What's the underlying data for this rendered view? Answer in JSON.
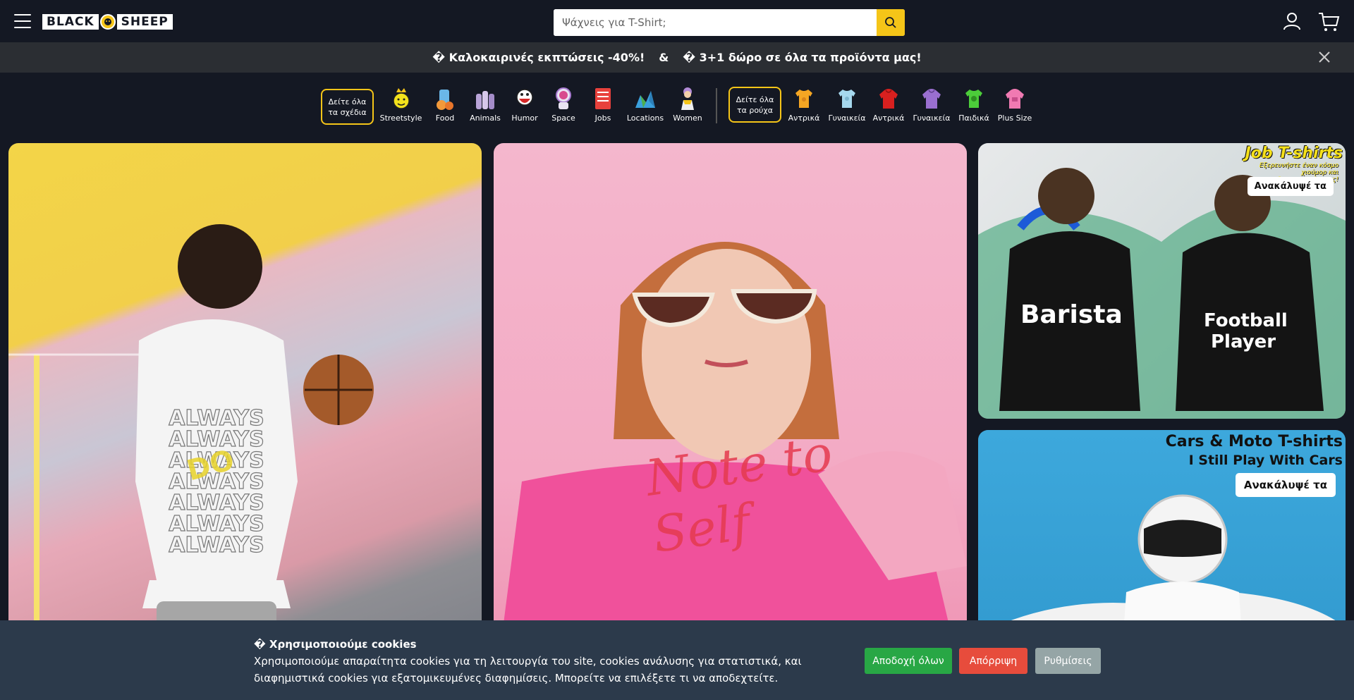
{
  "header": {
    "logo_text_left": "BLACK",
    "logo_text_right": "SHEEP",
    "search_placeholder": "Ψάχνεις για T-Shirt;"
  },
  "promo": {
    "text_1": "� Καλοκαιρινές εκπτώσεις -40%!",
    "separator": "&",
    "text_2": "� 3+1 δώρο σε όλα τα προϊόντα μας!"
  },
  "categories": {
    "designs_button": "Δείτε όλα τα σχέδια",
    "designs": [
      "Streetstyle",
      "Food",
      "Animals",
      "Humor",
      "Space",
      "Jobs",
      "Locations",
      "Women"
    ],
    "clothes_button": "Δείτε όλα τα ρούχα",
    "clothes": [
      "Αντρικά",
      "Γυναικεία",
      "Αντρικά",
      "Γυναικεία",
      "Παιδικά",
      "Plus Size"
    ]
  },
  "cards": {
    "job_title": "Job T-shirts",
    "job_subtitle": "Εξερευνήστε έναν κόσμο χιούμορ και δημιουργικότητας!",
    "job_button": "Ανακάλυψέ τα",
    "cars_title_1": "Cars & Moto T-shirts",
    "cars_title_2": "I Still Play With Cars",
    "cars_button": "Ανακάλυψέ τα"
  },
  "cookie": {
    "title": "� Χρησιμοποιούμε cookies",
    "body": "Χρησιμοποιούμε απαραίτητα cookies για τη λειτουργία του site, cookies ανάλυσης για στατιστικά, και διαφημιστικά cookies για εξατομικευμένες διαφημίσεις. Μπορείτε να επιλέξετε τι να αποδεχτείτε.",
    "accept": "Αποδοχή όλων",
    "reject": "Απόρριψη",
    "settings": "Ρυθμίσεις"
  },
  "colors": {
    "background": "#141823",
    "accent": "#f5c518",
    "promo_bar": "#2b2e33",
    "cookie_bar": "#2c3a4b",
    "accept": "#28a745",
    "reject": "#e74c3c",
    "settings": "#95a5a6"
  },
  "icons": [
    "menu-icon",
    "sheep-logo-icon",
    "search-icon",
    "user-icon",
    "cart-icon",
    "close-icon"
  ]
}
